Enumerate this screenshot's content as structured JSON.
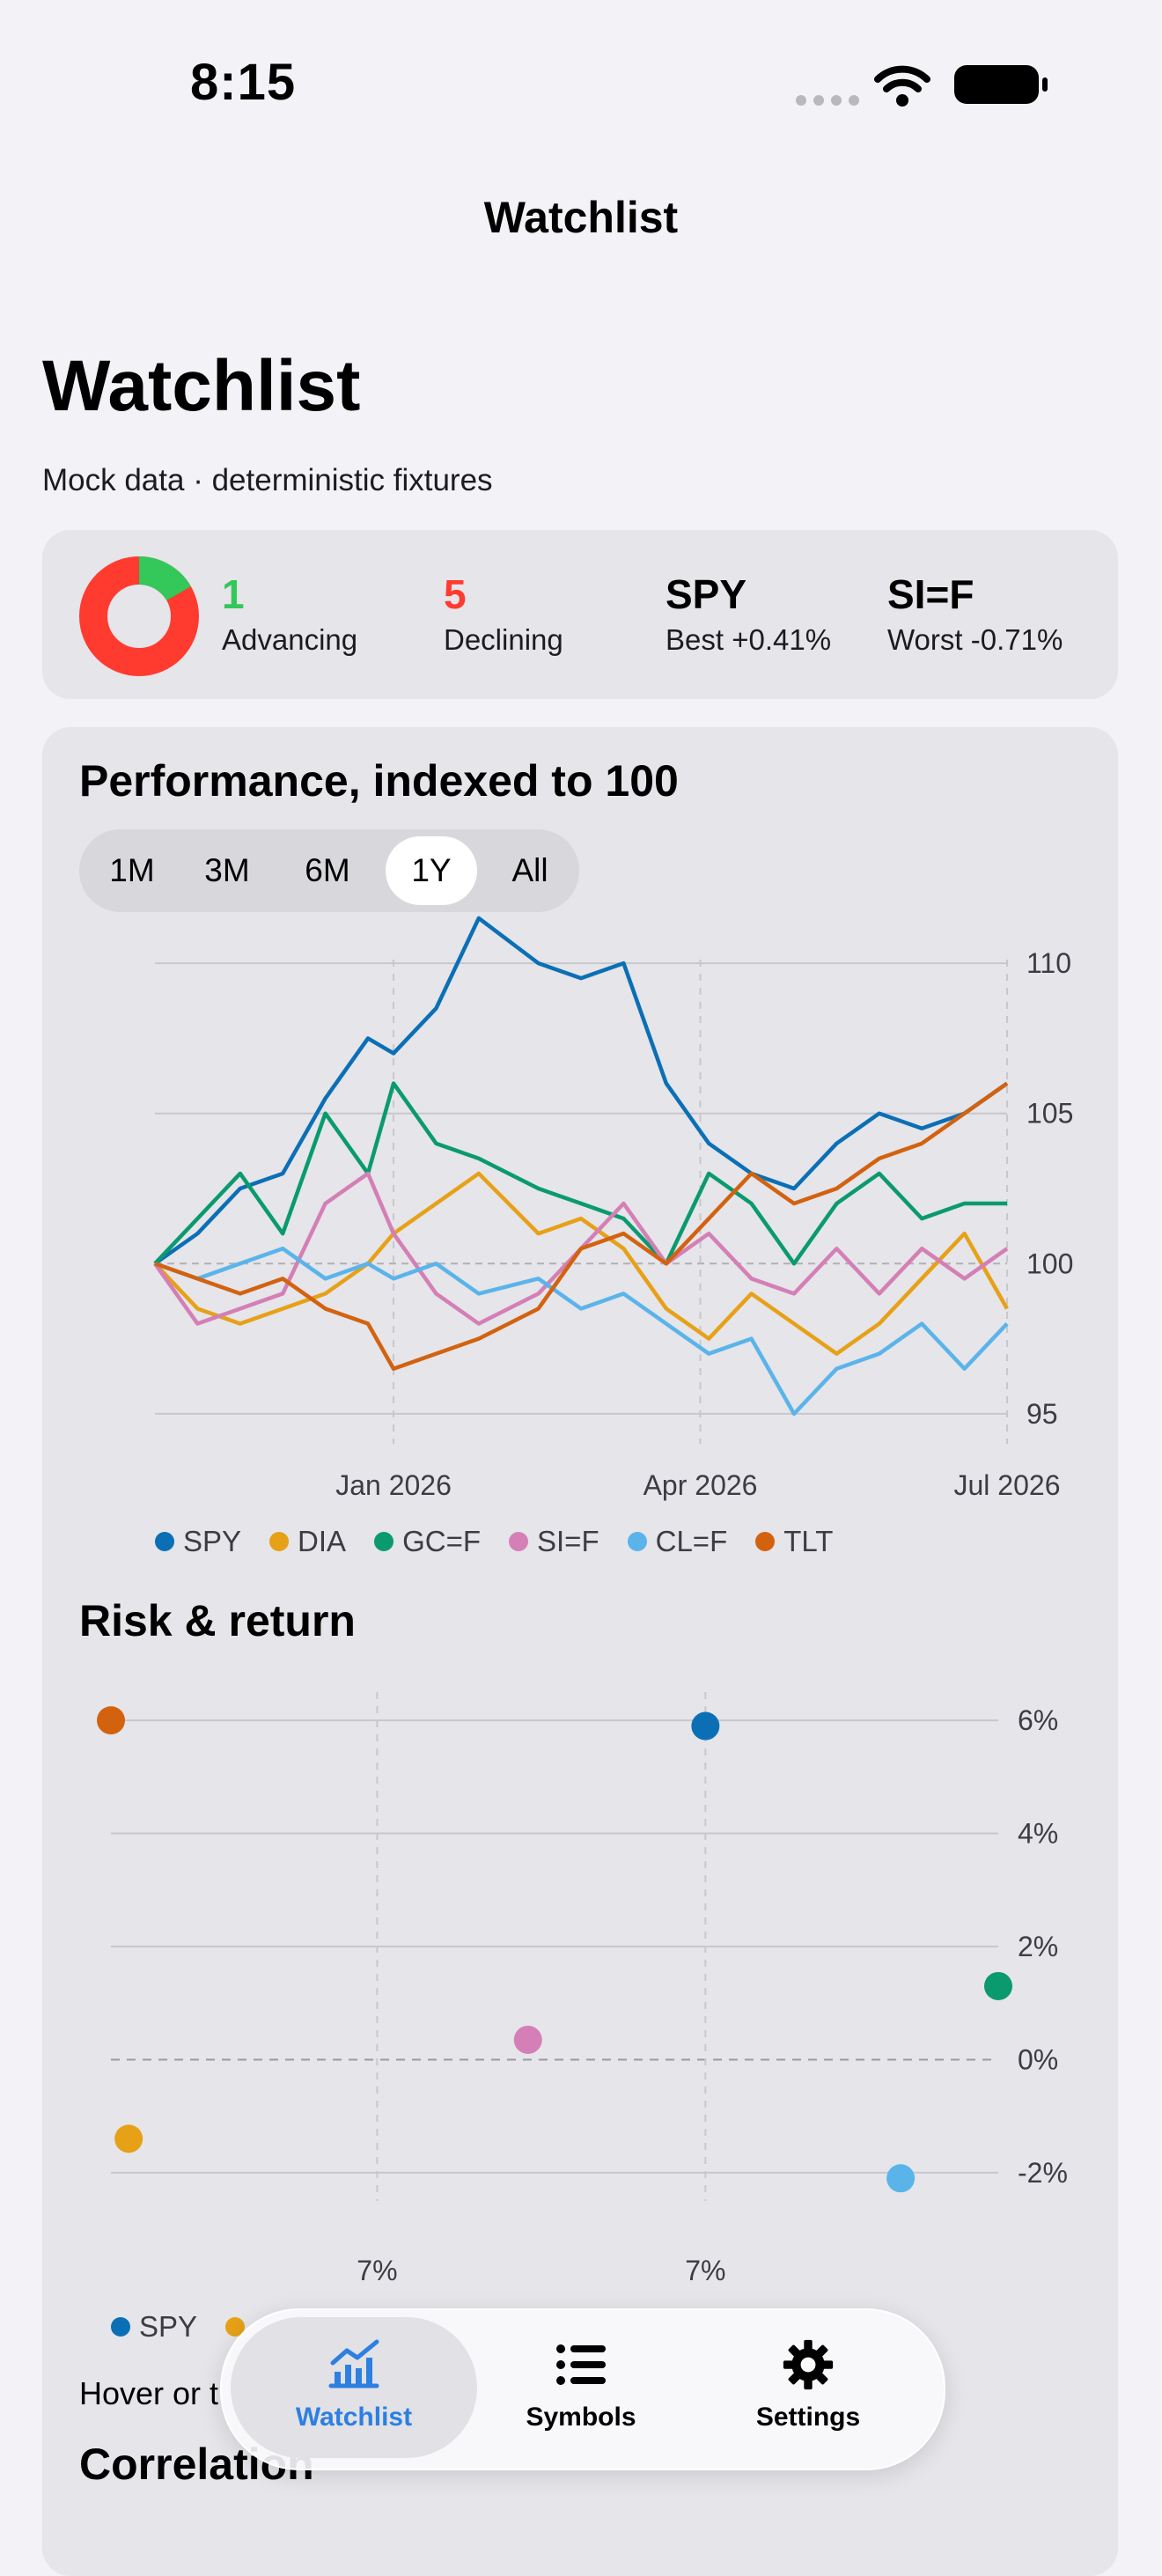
{
  "status_bar": {
    "time": "8:15"
  },
  "nav": {
    "title": "Watchlist"
  },
  "header": {
    "title": "Watchlist",
    "subtitle": "Mock data · deterministic fixtures"
  },
  "summary": {
    "advancing_count": "1",
    "advancing_label": "Advancing",
    "declining_count": "5",
    "declining_label": "Declining",
    "best_symbol": "SPY",
    "best_label": "Best +0.41%",
    "worst_symbol": "SI=F",
    "worst_label": "Worst -0.71%",
    "donut": {
      "advancing": 1,
      "declining": 5,
      "advancing_color": "#34c759",
      "declining_color": "#ff3b30"
    }
  },
  "performance": {
    "title": "Performance, indexed to 100",
    "ranges": [
      "1M",
      "3M",
      "6M",
      "1Y",
      "All"
    ],
    "selected_range": "1Y"
  },
  "risk": {
    "title": "Risk & return",
    "hint_visible": "Hover or t"
  },
  "correlation": {
    "title": "Correlation"
  },
  "tabs": [
    {
      "label": "Watchlist",
      "icon": "chart-icon",
      "selected": true
    },
    {
      "label": "Symbols",
      "icon": "list-icon",
      "selected": false
    },
    {
      "label": "Settings",
      "icon": "gear-icon",
      "selected": false
    }
  ],
  "colors": {
    "accent": "#2d7fe0",
    "spy": "#0b6fb5",
    "dia": "#e6a117",
    "gcf": "#0a9a6e",
    "sif": "#d47fb5",
    "clf": "#5ab4ea",
    "tlt": "#d3620f"
  },
  "chart_data": [
    {
      "type": "line",
      "title": "Performance, indexed to 100",
      "x_tick_labels": [
        "Jan 2026",
        "Apr 2026",
        "Jul 2026"
      ],
      "y_tick_labels": [
        "95",
        "100",
        "105",
        "110"
      ],
      "ylim": [
        94,
        111
      ],
      "grid": true,
      "legend_position": "bottom",
      "x": [
        0,
        0.05,
        0.1,
        0.15,
        0.2,
        0.25,
        0.28,
        0.33,
        0.38,
        0.45,
        0.5,
        0.55,
        0.6,
        0.65,
        0.7,
        0.75,
        0.8,
        0.85,
        0.9,
        0.95,
        1.0
      ],
      "series": [
        {
          "name": "SPY",
          "color": "#0b6fb5",
          "values": [
            100,
            101,
            102.5,
            103,
            105.5,
            107.5,
            107,
            108.5,
            111.5,
            110,
            109.5,
            110,
            106,
            104,
            103,
            102.5,
            104,
            105,
            104.5,
            105,
            106
          ]
        },
        {
          "name": "DIA",
          "color": "#e6a117",
          "values": [
            100,
            98.5,
            98,
            98.5,
            99,
            100,
            101,
            102,
            103,
            101,
            101.5,
            100.5,
            98.5,
            97.5,
            99,
            98,
            97,
            98,
            99.5,
            101,
            98.5
          ]
        },
        {
          "name": "GC=F",
          "color": "#0a9a6e",
          "values": [
            100,
            101.5,
            103,
            101,
            105,
            103,
            106,
            104,
            103.5,
            102.5,
            102,
            101.5,
            100,
            103,
            102,
            100,
            102,
            103,
            101.5,
            102,
            102
          ]
        },
        {
          "name": "SI=F",
          "color": "#d47fb5",
          "values": [
            100,
            98,
            98.5,
            99,
            102,
            103,
            101,
            99,
            98,
            99,
            100.5,
            102,
            100,
            101,
            99.5,
            99,
            100.5,
            99,
            100.5,
            99.5,
            100.5
          ]
        },
        {
          "name": "CL=F",
          "color": "#5ab4ea",
          "values": [
            100,
            99.5,
            100,
            100.5,
            99.5,
            100,
            99.5,
            100,
            99,
            99.5,
            98.5,
            99,
            98,
            97,
            97.5,
            95,
            96.5,
            97,
            98,
            96.5,
            98
          ]
        },
        {
          "name": "TLT",
          "color": "#d3620f",
          "values": [
            100,
            99.5,
            99,
            99.5,
            98.5,
            98,
            96.5,
            97,
            97.5,
            98.5,
            100.5,
            101,
            100,
            101.5,
            103,
            102,
            102.5,
            103.5,
            104,
            105,
            106
          ]
        }
      ]
    },
    {
      "type": "scatter",
      "title": "Risk & return",
      "x_tick_labels": [
        "7%",
        "7%"
      ],
      "y_tick_labels": [
        "-2%",
        "0%",
        "2%",
        "4%",
        "6%"
      ],
      "ylim": [
        -2.5,
        6.5
      ],
      "grid": true,
      "legend_position": "bottom",
      "points": [
        {
          "name": "TLT",
          "color": "#d3620f",
          "x": 0.0,
          "y": 6.0
        },
        {
          "name": "SPY",
          "color": "#0b6fb5",
          "x": 0.67,
          "y": 5.9
        },
        {
          "name": "GC=F",
          "color": "#0a9a6e",
          "x": 1.0,
          "y": 1.3
        },
        {
          "name": "SI=F",
          "color": "#d47fb5",
          "x": 0.47,
          "y": 0.35
        },
        {
          "name": "DIA",
          "color": "#e6a117",
          "x": 0.02,
          "y": -1.4
        },
        {
          "name": "CL=F",
          "color": "#5ab4ea",
          "x": 0.89,
          "y": -2.1
        }
      ],
      "visible_legend": [
        "SPY"
      ]
    }
  ]
}
